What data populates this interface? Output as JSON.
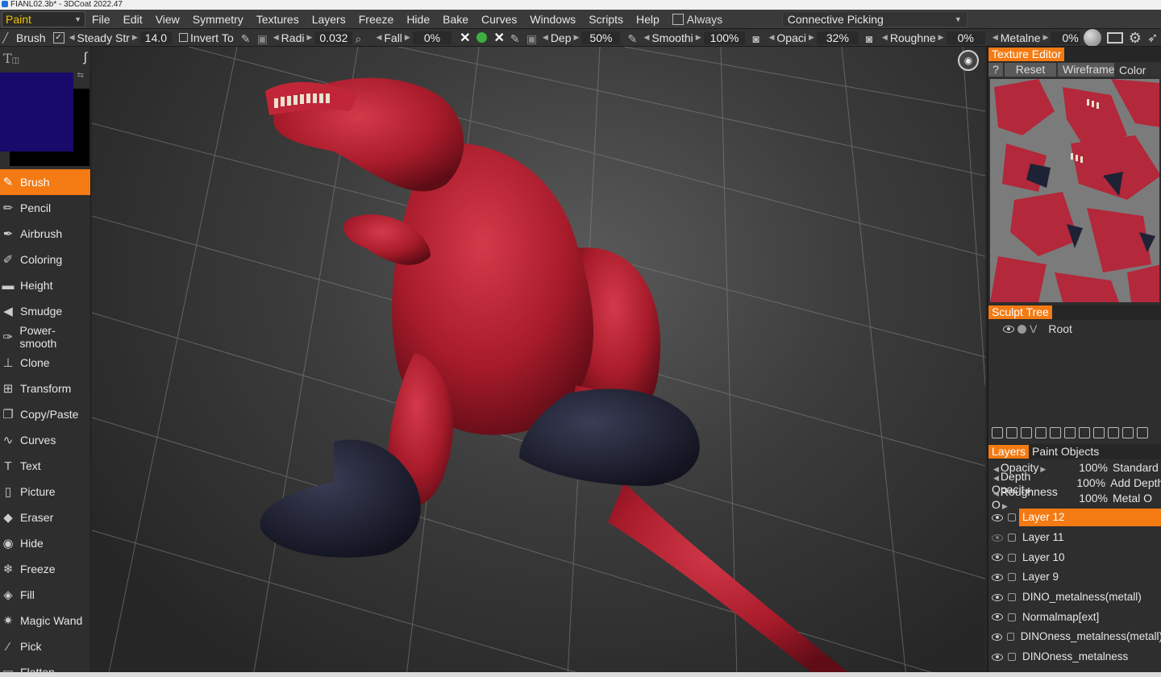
{
  "window": {
    "title": "FIANL02.3b* - 3DCoat 2022.47"
  },
  "menubar": {
    "mode": "Paint",
    "items": [
      "File",
      "Edit",
      "View",
      "Symmetry",
      "Textures",
      "Layers",
      "Freeze",
      "Hide",
      "Bake",
      "Curves",
      "Windows",
      "Scripts",
      "Help"
    ],
    "always_label": "Always",
    "picking_label": "Connective Picking"
  },
  "tool_options": {
    "brush_label": "Brush",
    "steady_label": "Steady",
    "str_label": "Str",
    "str_value": "14.0",
    "invert_label": "Invert",
    "to_label": "To",
    "radius_label": "Radi",
    "radius_value": "0.032",
    "falloff_label": "Fall",
    "falloff_value": "0%",
    "depth_label": "Dep",
    "depth_value": "50%",
    "smooth_label": "Smoothi",
    "smooth_value": "100%",
    "opacity_label": "Opaci",
    "opacity_value": "32%",
    "roughness_label": "Roughne",
    "roughness_value": "0%",
    "metalness_label": "Metalne",
    "metalness_value": "0%"
  },
  "palette": {
    "primary_color": "#180a6a",
    "secondary_color": "#000000"
  },
  "tools": [
    {
      "label": "Brush",
      "icon": "brush-icon",
      "active": true
    },
    {
      "label": "Pencil",
      "icon": "pencil-icon"
    },
    {
      "label": "Airbrush",
      "icon": "airbrush-icon"
    },
    {
      "label": "Coloring",
      "icon": "coloring-icon"
    },
    {
      "label": "Height",
      "icon": "height-icon"
    },
    {
      "label": "Smudge",
      "icon": "smudge-icon"
    },
    {
      "label": "Power-smooth",
      "icon": "power-smooth-icon"
    },
    {
      "label": "Clone",
      "icon": "clone-icon"
    },
    {
      "label": "Transform",
      "icon": "transform-icon"
    },
    {
      "label": "Copy/Paste",
      "icon": "copy-paste-icon"
    },
    {
      "label": "Curves",
      "icon": "curves-icon"
    },
    {
      "label": "Text",
      "icon": "text-icon"
    },
    {
      "label": "Picture",
      "icon": "picture-icon"
    },
    {
      "label": "Eraser",
      "icon": "eraser-icon"
    },
    {
      "label": "Hide",
      "icon": "eye-icon"
    },
    {
      "label": "Freeze",
      "icon": "snowflake-icon"
    },
    {
      "label": "Fill",
      "icon": "fill-icon"
    },
    {
      "label": "Magic Wand",
      "icon": "magic-wand-icon"
    },
    {
      "label": "Pick",
      "icon": "pick-icon"
    },
    {
      "label": "Flatten",
      "icon": "flatten-icon"
    }
  ],
  "texture_editor": {
    "title": "Texture Editor",
    "help": "?",
    "reset": "Reset",
    "wireframe": "Wireframe",
    "color": "Color"
  },
  "sculpt_tree": {
    "title": "Sculpt Tree",
    "root": {
      "prefix": "V",
      "label": "Root"
    }
  },
  "layers_panel": {
    "tabs": [
      "Layers",
      "Paint Objects"
    ],
    "props": [
      {
        "label": "Opacity",
        "value": "100%",
        "mode": "Standard"
      },
      {
        "label": "Depth Opacit",
        "value": "100%",
        "mode": "Add Depth"
      },
      {
        "label": "Roughness O",
        "value": "100%",
        "mode": "Metal O"
      }
    ],
    "layers": [
      {
        "name": "Layer 12",
        "visible": true,
        "selected": true
      },
      {
        "name": "Layer 11",
        "visible": false
      },
      {
        "name": "Layer 10",
        "visible": true
      },
      {
        "name": "Layer 9",
        "visible": true
      },
      {
        "name": "DINO_metalness(metall)",
        "visible": true
      },
      {
        "name": "Normalmap[ext]",
        "visible": true
      },
      {
        "name": "DINOness_metalness(metall)",
        "visible": true
      },
      {
        "name": "DINOness_metalness",
        "visible": true
      }
    ]
  },
  "colors": {
    "accent": "#f47a13",
    "model": "#b01c2a",
    "feet": "#1a1c2e"
  }
}
